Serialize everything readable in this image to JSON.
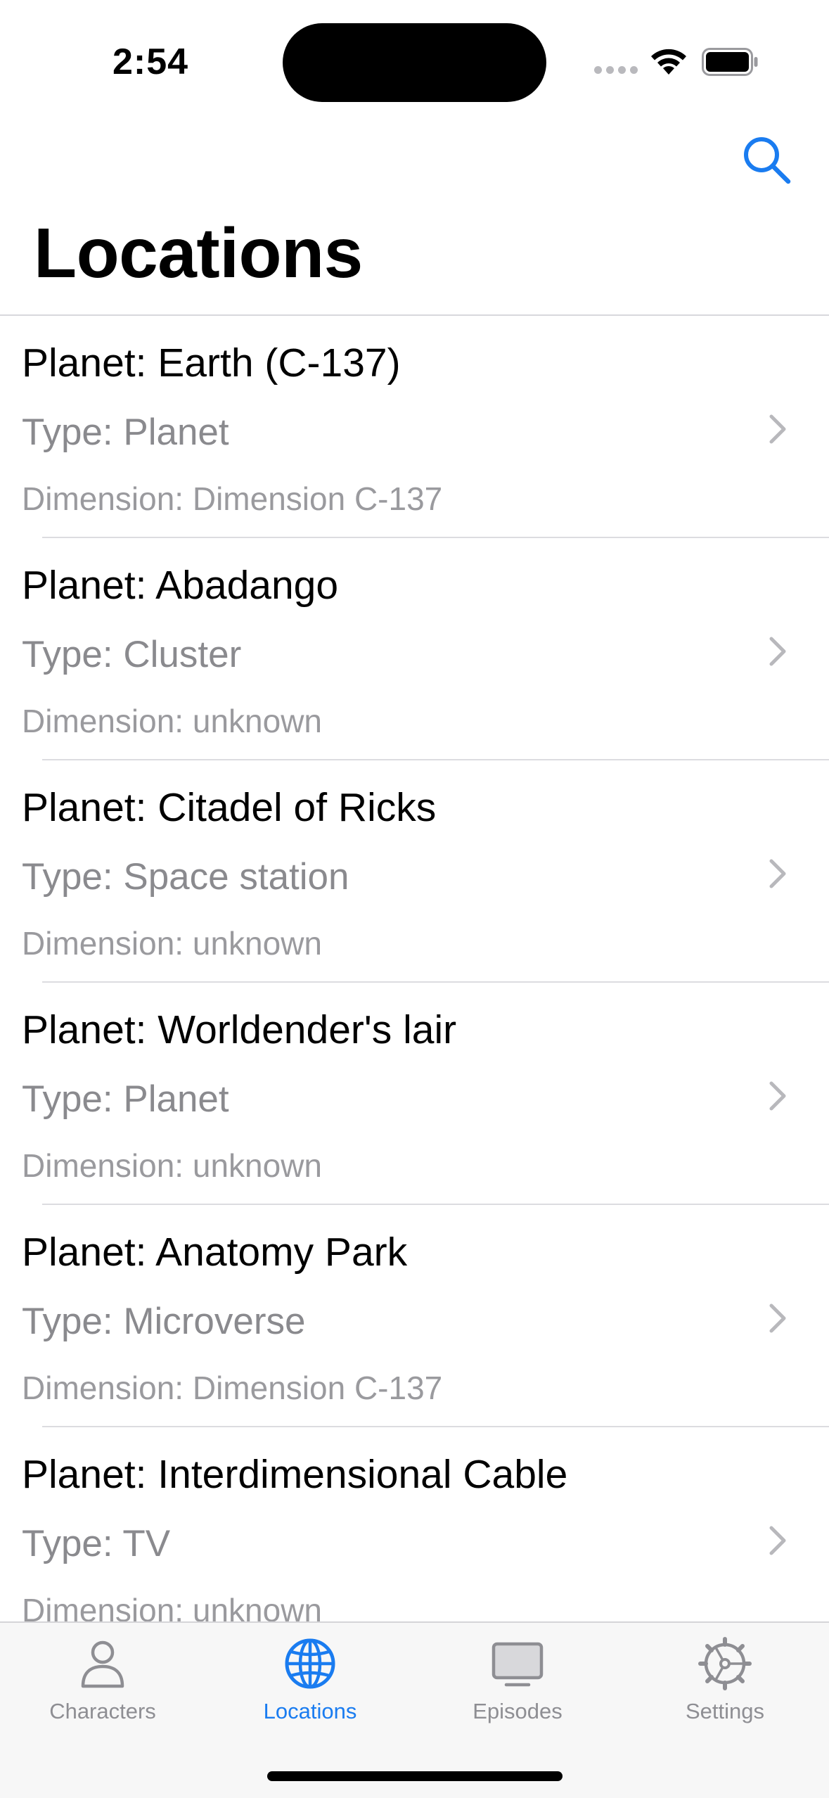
{
  "status": {
    "time": "2:54"
  },
  "nav": {
    "title": "Locations",
    "search_icon": "search-icon"
  },
  "locations": [
    {
      "name": "Planet: Earth (C-137)",
      "type": "Type: Planet",
      "dimension": "Dimension: Dimension C-137"
    },
    {
      "name": "Planet: Abadango",
      "type": "Type: Cluster",
      "dimension": "Dimension: unknown"
    },
    {
      "name": "Planet: Citadel of Ricks",
      "type": "Type: Space station",
      "dimension": "Dimension: unknown"
    },
    {
      "name": "Planet: Worldender's lair",
      "type": "Type: Planet",
      "dimension": "Dimension: unknown"
    },
    {
      "name": "Planet: Anatomy Park",
      "type": "Type: Microverse",
      "dimension": "Dimension: Dimension C-137"
    },
    {
      "name": "Planet: Interdimensional Cable",
      "type": "Type: TV",
      "dimension": "Dimension: unknown"
    }
  ],
  "tabbar": {
    "tabs": [
      {
        "label": "Characters",
        "icon": "person-icon",
        "active": false
      },
      {
        "label": "Locations",
        "icon": "globe-icon",
        "active": true
      },
      {
        "label": "Episodes",
        "icon": "tv-icon",
        "active": false
      },
      {
        "label": "Settings",
        "icon": "gear-icon",
        "active": false
      }
    ]
  },
  "colors": {
    "accent": "#1a7cf0",
    "secondary_text": "#8a8a8e",
    "inactive_tab": "#8e8e93"
  }
}
